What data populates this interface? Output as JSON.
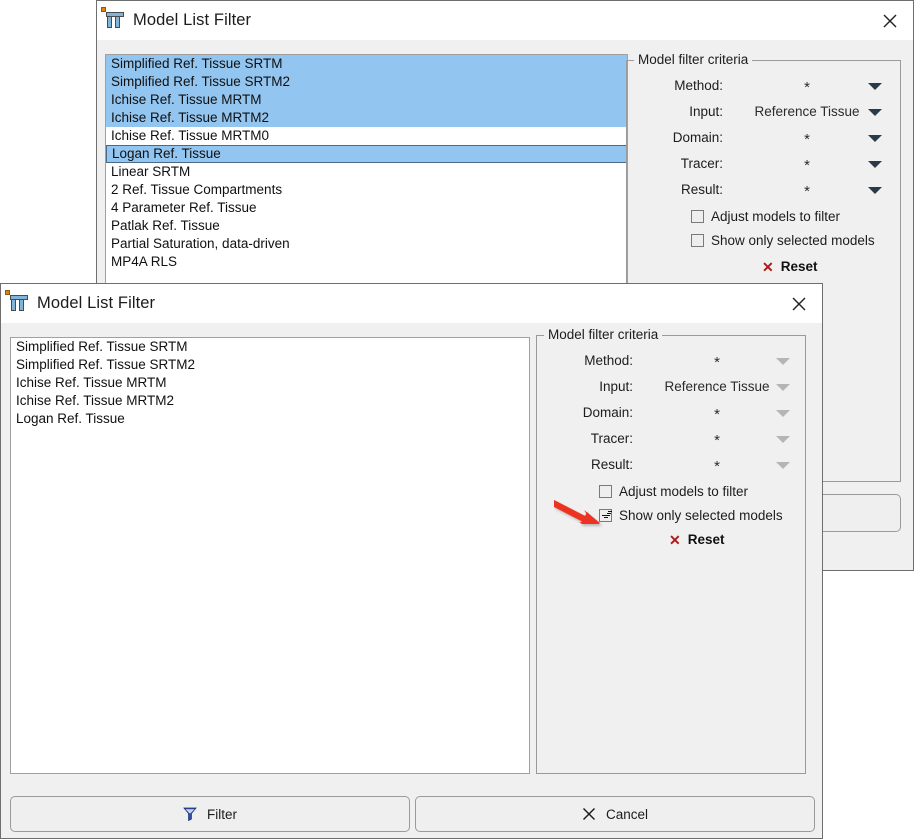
{
  "back_window": {
    "title": "Model List Filter",
    "icon": "app-pi-icon",
    "close_icon": "close-icon",
    "models": [
      {
        "label": "Simplified Ref. Tissue SRTM",
        "state": "selected"
      },
      {
        "label": "Simplified Ref. Tissue SRTM2",
        "state": "selected"
      },
      {
        "label": "Ichise Ref. Tissue MRTM",
        "state": "selected"
      },
      {
        "label": "Ichise Ref. Tissue MRTM2",
        "state": "selected"
      },
      {
        "label": "Ichise Ref. Tissue MRTM0",
        "state": "normal"
      },
      {
        "label": "Logan Ref. Tissue",
        "state": "focused"
      },
      {
        "label": "Linear SRTM",
        "state": "normal"
      },
      {
        "label": "2 Ref. Tissue Compartments",
        "state": "normal"
      },
      {
        "label": "4 Parameter Ref. Tissue",
        "state": "normal"
      },
      {
        "label": "Patlak Ref. Tissue",
        "state": "normal"
      },
      {
        "label": "Partial Saturation, data-driven",
        "state": "normal"
      },
      {
        "label": "MP4A RLS",
        "state": "normal"
      }
    ],
    "criteria": {
      "legend": "Model filter criteria",
      "fields": [
        {
          "label": "Method:",
          "value": "*"
        },
        {
          "label": "Input:",
          "value": "Reference Tissue"
        },
        {
          "label": "Domain:",
          "value": "*"
        },
        {
          "label": "Tracer:",
          "value": "*"
        },
        {
          "label": "Result:",
          "value": "*"
        }
      ],
      "checkboxes": [
        {
          "label": "Adjust models to filter",
          "checked": false
        },
        {
          "label": "Show only selected models",
          "checked": false
        }
      ],
      "reset_label": "Reset",
      "reset_icon": "x-icon"
    }
  },
  "front_window": {
    "title": "Model List Filter",
    "icon": "app-pi-icon",
    "close_icon": "close-icon",
    "models": [
      {
        "label": "Simplified Ref. Tissue SRTM",
        "state": "normal"
      },
      {
        "label": "Simplified Ref. Tissue SRTM2",
        "state": "normal"
      },
      {
        "label": "Ichise Ref. Tissue MRTM",
        "state": "normal"
      },
      {
        "label": "Ichise Ref. Tissue MRTM2",
        "state": "normal"
      },
      {
        "label": "Logan Ref. Tissue",
        "state": "normal"
      }
    ],
    "criteria": {
      "legend": "Model filter criteria",
      "fields": [
        {
          "label": "Method:",
          "value": "*"
        },
        {
          "label": "Input:",
          "value": "Reference Tissue"
        },
        {
          "label": "Domain:",
          "value": "*"
        },
        {
          "label": "Tracer:",
          "value": "*"
        },
        {
          "label": "Result:",
          "value": "*"
        }
      ],
      "checkboxes": [
        {
          "label": "Adjust models to filter",
          "checked": false
        },
        {
          "label": "Show only selected models",
          "checked": true
        }
      ],
      "reset_label": "Reset",
      "reset_icon": "x-icon"
    },
    "buttons": [
      {
        "label": "Filter",
        "icon": "funnel-icon"
      },
      {
        "label": "Cancel",
        "icon": "x-icon"
      }
    ]
  },
  "annotation": {
    "type": "red-arrow",
    "points_at": "show-only-selected-models-checkbox",
    "color": "#ee3322"
  }
}
